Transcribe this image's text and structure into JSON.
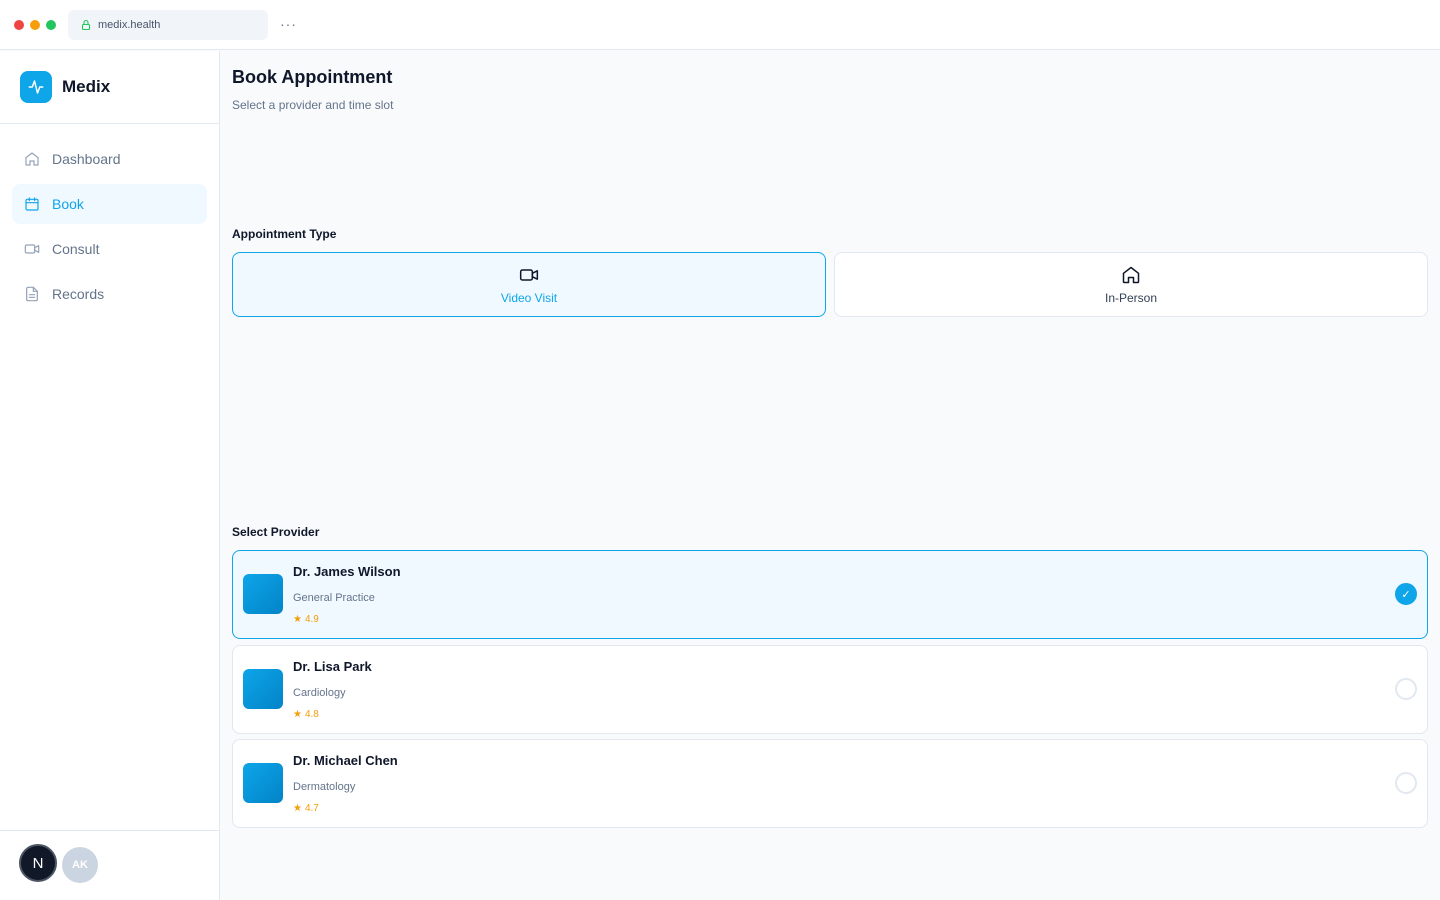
{
  "browser": {
    "url": "medix.health",
    "menu_label": "···"
  },
  "sidebar": {
    "brand_name": "Medix",
    "items": [
      {
        "label": "Dashboard",
        "icon": "home-icon",
        "active": false
      },
      {
        "label": "Book",
        "icon": "calendar-icon",
        "active": true
      },
      {
        "label": "Consult",
        "icon": "video-icon",
        "active": false
      },
      {
        "label": "Records",
        "icon": "document-icon",
        "active": false
      }
    ],
    "footer": {
      "badge_letter": "N",
      "avatar_initials": "AK"
    }
  },
  "main": {
    "title": "Book Appointment",
    "subtitle": "Select a provider and time slot",
    "appointment_type": {
      "label": "Appointment Type",
      "options": [
        {
          "label": "Video Visit",
          "icon": "video-camera-icon",
          "selected": true
        },
        {
          "label": "In-Person",
          "icon": "building-icon",
          "selected": false
        }
      ]
    },
    "providers": {
      "label": "Select Provider",
      "list": [
        {
          "name": "Dr. James Wilson",
          "specialty": "General Practice",
          "rating": "4.9",
          "selected": true
        },
        {
          "name": "Dr. Lisa Park",
          "specialty": "Cardiology",
          "rating": "4.8",
          "selected": false
        },
        {
          "name": "Dr. Michael Chen",
          "specialty": "Dermatology",
          "rating": "4.7",
          "selected": false
        }
      ],
      "star_glyph": "★",
      "check_glyph": "✓"
    }
  },
  "colors": {
    "accent": "#0ea5e9",
    "rating": "#f59e0b",
    "border": "#e2e8f0"
  }
}
